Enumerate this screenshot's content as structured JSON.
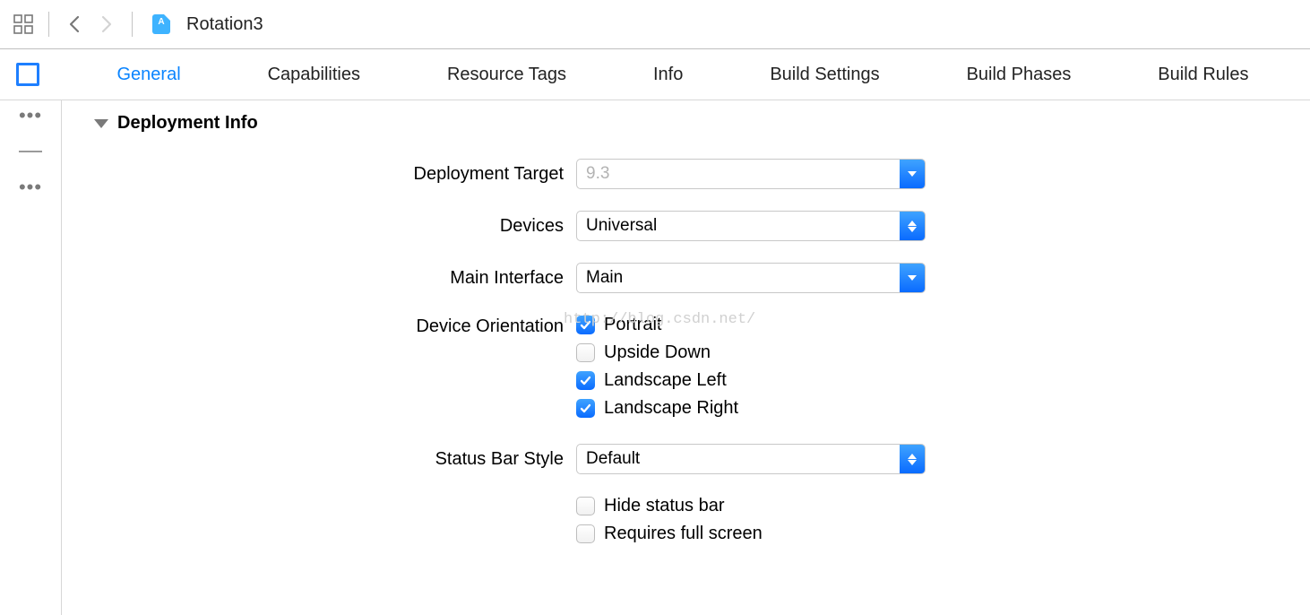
{
  "toolbar": {
    "project_title": "Rotation3"
  },
  "tabs": {
    "items": [
      "General",
      "Capabilities",
      "Resource Tags",
      "Info",
      "Build Settings",
      "Build Phases",
      "Build Rules"
    ],
    "active_index": 0
  },
  "section": {
    "title": "Deployment Info"
  },
  "fields": {
    "deployment_target": {
      "label": "Deployment Target",
      "placeholder": "9.3",
      "value": ""
    },
    "devices": {
      "label": "Devices",
      "value": "Universal"
    },
    "main_interface": {
      "label": "Main Interface",
      "value": "Main"
    },
    "device_orientation": {
      "label": "Device Orientation",
      "options": [
        {
          "label": "Portrait",
          "checked": true
        },
        {
          "label": "Upside Down",
          "checked": false
        },
        {
          "label": "Landscape Left",
          "checked": true
        },
        {
          "label": "Landscape Right",
          "checked": true
        }
      ]
    },
    "status_bar_style": {
      "label": "Status Bar Style",
      "value": "Default"
    },
    "extra_checks": {
      "options": [
        {
          "label": "Hide status bar",
          "checked": false
        },
        {
          "label": "Requires full screen",
          "checked": false
        }
      ]
    }
  },
  "watermark": "http://blog.csdn.net/"
}
